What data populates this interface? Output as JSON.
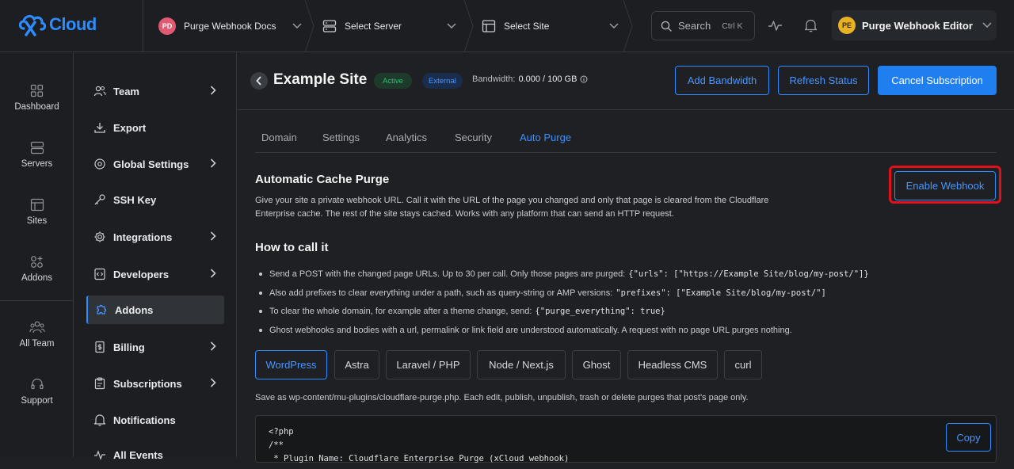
{
  "brand": {
    "logo_text": "Cloud",
    "accent": "#2d8cff"
  },
  "topbar": {
    "workspace": {
      "initials": "PD",
      "label": "Purge Webhook Docs"
    },
    "server": {
      "label": "Select Server"
    },
    "site": {
      "label": "Select Site"
    },
    "search": {
      "label": "Search",
      "shortcut": "Ctrl K"
    },
    "user": {
      "initials": "PE",
      "label": "Purge Webhook Editor"
    }
  },
  "rail": {
    "items": [
      {
        "label": "Dashboard",
        "icon": "dashboard-icon"
      },
      {
        "label": "Servers",
        "icon": "servers-icon"
      },
      {
        "label": "Sites",
        "icon": "sites-icon"
      },
      {
        "label": "Addons",
        "icon": "addons-icon"
      },
      {
        "label": "All Team",
        "icon": "team-icon"
      },
      {
        "label": "Support",
        "icon": "support-icon"
      }
    ]
  },
  "nav": {
    "items": [
      {
        "label": "Team",
        "icon": "users-icon",
        "has_arrow": true
      },
      {
        "label": "Export",
        "icon": "download-icon",
        "has_arrow": false
      },
      {
        "label": "Global Settings",
        "icon": "globe-gear-icon",
        "has_arrow": true
      },
      {
        "label": "SSH Key",
        "icon": "key-icon",
        "has_arrow": false
      },
      {
        "label": "Integrations",
        "icon": "gear-icon",
        "has_arrow": true
      },
      {
        "label": "Developers",
        "icon": "code-file-icon",
        "has_arrow": true
      },
      {
        "label": "Addons",
        "icon": "puzzle-icon",
        "has_arrow": false,
        "active": true
      },
      {
        "label": "Billing",
        "icon": "receipt-icon",
        "has_arrow": true
      },
      {
        "label": "Subscriptions",
        "icon": "clipboard-icon",
        "has_arrow": true
      },
      {
        "label": "Notifications",
        "icon": "bell-icon",
        "has_arrow": false
      },
      {
        "label": "All Events",
        "icon": "activity-icon",
        "has_arrow": false
      }
    ]
  },
  "site_header": {
    "title": "Example Site",
    "status_badge": "Active",
    "type_badge": "External",
    "bandwidth_label": "Bandwidth:",
    "bandwidth_value": "0.000 / 100 GB",
    "add_bandwidth": "Add Bandwidth",
    "refresh_status": "Refresh Status",
    "cancel_subscription": "Cancel Subscription"
  },
  "tabs": [
    {
      "label": "Domain",
      "active": false
    },
    {
      "label": "Settings",
      "active": false
    },
    {
      "label": "Analytics",
      "active": false
    },
    {
      "label": "Security",
      "active": false
    },
    {
      "label": "Auto Purge",
      "active": true
    }
  ],
  "purge": {
    "title": "Automatic Cache Purge",
    "description_1": "Give your site a private webhook URL. Call it with the URL of the page you changed and only that page is cleared from the Cloudflare",
    "description_2": "Enterprise cache. The rest of the site stays cached. Works with any platform that can send an HTTP request.",
    "enable_webhook": "Enable Webhook",
    "how_title": "How to call it",
    "bullets": [
      {
        "text": "Send a POST with the changed page URLs. Up to 30 per call. Only those pages are purged:",
        "code": "{\"urls\": [\"https://Example Site/blog/my-post/\"]}"
      },
      {
        "text": "Also add prefixes to clear everything under a path, such as query-string or AMP versions:",
        "code": "\"prefixes\": [\"Example Site/blog/my-post/\"]"
      },
      {
        "text": "To clear the whole domain, for example after a theme change, send:",
        "code": "{\"purge_everything\": true}"
      },
      {
        "text": "Ghost webhooks and bodies with a url, permalink or link field are understood automatically. A request with no page URL purges nothing.",
        "code": ""
      }
    ],
    "platforms": [
      "WordPress",
      "Astra",
      "Laravel / PHP",
      "Node / Next.js",
      "Ghost",
      "Headless CMS",
      "curl"
    ],
    "active_platform": "WordPress",
    "note": "Save as wp-content/mu-plugins/cloudflare-purge.php. Each edit, publish, unpublish, trash or delete purges that post's page only.",
    "code_lines": [
      "<?php",
      "/**",
      " * Plugin Name: Cloudflare Enterprise Purge (xCloud webhook)"
    ],
    "copy_label": "Copy"
  }
}
